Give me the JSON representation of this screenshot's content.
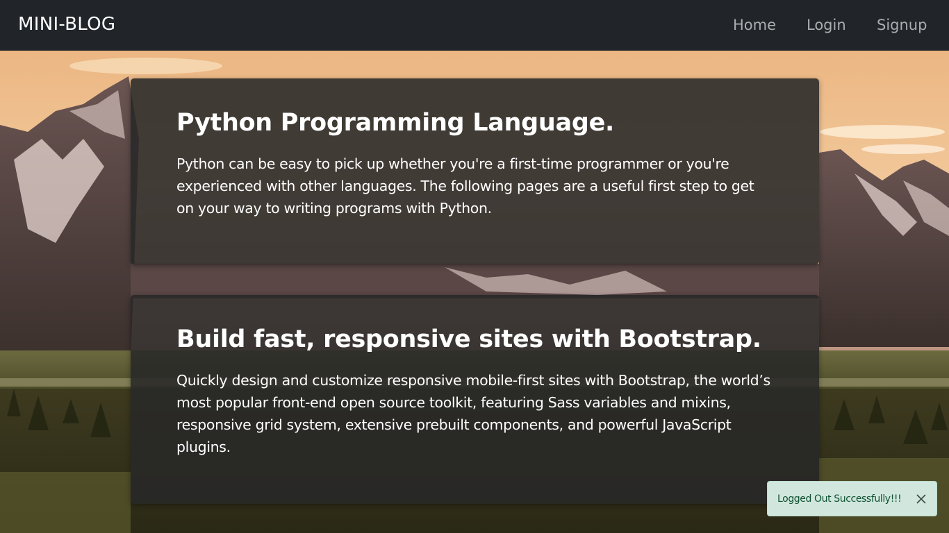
{
  "navbar": {
    "brand": "MINI-BLOG",
    "links": [
      "Home",
      "Login",
      "Signup"
    ]
  },
  "posts": [
    {
      "title": "Python Programming Language.",
      "body": "Python can be easy to pick up whether you're a first-time programmer or you're experienced with other languages. The following pages are a useful first step to get on your way to writing programs with Python."
    },
    {
      "title": "Build fast, responsive sites with Bootstrap.",
      "body": "Quickly design and customize responsive mobile-first sites with Bootstrap, the world’s most popular front-end open source toolkit, featuring Sass variables and mixins, responsive grid system, extensive prebuilt components, and powerful JavaScript plugins."
    }
  ],
  "toast": {
    "message": "Logged Out Successfully!!!",
    "close_icon": "close-icon"
  },
  "colors": {
    "navbar_bg": "#212529",
    "card_bg": "rgba(40,40,40,0.88)",
    "toast_bg": "#d1e7dd",
    "toast_text": "#0f5132"
  }
}
